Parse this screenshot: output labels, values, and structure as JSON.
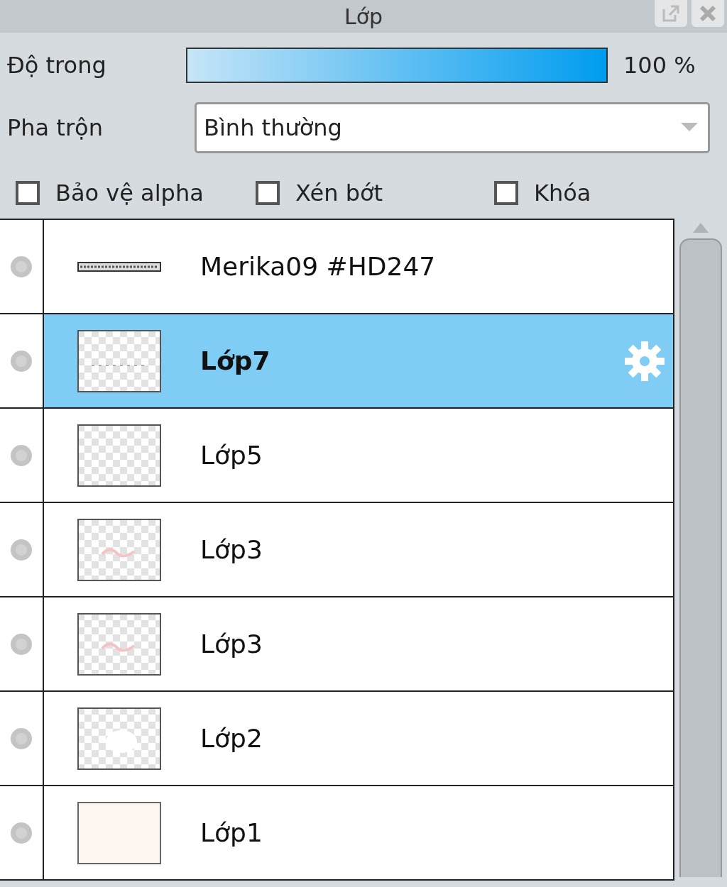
{
  "window": {
    "title": "Lớp"
  },
  "opacity": {
    "label": "Độ trong",
    "level": 1,
    "reading": "100 %"
  },
  "blend": {
    "label": "Pha trộn",
    "value": "Bình thường"
  },
  "options": [
    {
      "label": "Bảo vệ alpha",
      "checked": false
    },
    {
      "label": "Xén bớt",
      "checked": false
    },
    {
      "label": "Khóa",
      "checked": false
    }
  ],
  "layers": [
    {
      "name": "Merika09 #HD247",
      "kind": "strip",
      "selected": false
    },
    {
      "name": "Lớp7",
      "kind": "dashes",
      "selected": true
    },
    {
      "name": "Lớp5",
      "kind": "checker",
      "selected": false
    },
    {
      "name": "Lớp3",
      "kind": "marks",
      "selected": false
    },
    {
      "name": "Lớp3",
      "kind": "marks",
      "selected": false
    },
    {
      "name": "Lớp2",
      "kind": "blob",
      "selected": false
    },
    {
      "name": "Lớp1",
      "kind": "solid",
      "selected": false
    }
  ]
}
